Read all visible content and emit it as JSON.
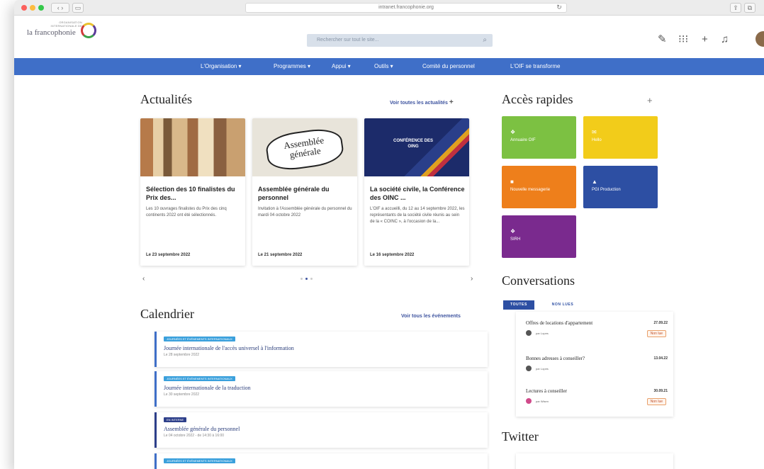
{
  "browser": {
    "url": "intranet.francophonie.org"
  },
  "header": {
    "logo_small": "ORGANISATION INTERNATIONALE DE",
    "logo_text": "la francophonie",
    "search_placeholder": "Rechercher sur tout le site..."
  },
  "nav": [
    "L'Organisation ▾",
    "Programmes ▾",
    "Appui ▾",
    "Outils ▾",
    "Comité du personnel",
    "L'OIF se transforme"
  ],
  "news": {
    "title": "Actualités",
    "see_all": "Voir toutes les actualités",
    "items": [
      {
        "title": "Sélection des 10 finalistes du Prix des...",
        "desc": "Les 10 ouvrages finalistes du Prix des cinq continents 2022 ont été sélectionnés.",
        "date": "Le 23 septembre 2022"
      },
      {
        "title": "Assemblée générale du personnel",
        "desc": "Invitation à l'Assemblée générale du personnel du mardi 04 octobre 2022",
        "date": "Le 21 septembre 2022"
      },
      {
        "title": "La société civile, la Conférence des OINC ...",
        "desc": "L'OIF a accueilli, du 12 au 14 septembre 2022, les représentants de la société civile réunis au sein de la « COINC », à l'occasion de la...",
        "date": "Le 16 septembre 2022"
      }
    ],
    "img2_text": "Assemblée générale",
    "img3_text": "CONFÉRENCE DES OING"
  },
  "calendar": {
    "title": "Calendrier",
    "see_all": "Voir tous les événements",
    "events": [
      {
        "tag": "JOURNÉES ET ÉVÉNEMENTS INTERNATIONAUX",
        "title": "Journée internationale de l'accès universel à l'information",
        "date": "Le 28 septembre 2022"
      },
      {
        "tag": "JOURNÉES ET ÉVÉNEMENTS INTERNATIONAUX",
        "title": "Journée internationale de la traduction",
        "date": "Le 30 septembre 2022"
      },
      {
        "tag": "EN INTERNE",
        "title": "Assemblée générale du personnel",
        "date": "Le 04 octobre 2022 - de 14:30 à 16:00"
      },
      {
        "tag": "JOURNÉES ET ÉVÉNEMENTS INTERNATIONAUX",
        "title": "",
        "date": ""
      }
    ]
  },
  "quick": {
    "title": "Accès rapides",
    "tiles": [
      {
        "label": "Annuaire OIF",
        "color": "#7cc142"
      },
      {
        "label": "Hello",
        "color": "#f2cc1a"
      },
      {
        "label": "Nouvelle messagerie",
        "color": "#ee7f1b"
      },
      {
        "label": "PGI Production",
        "color": "#2d4fa3"
      },
      {
        "label": "SIRH",
        "color": "#7a2a8e"
      }
    ]
  },
  "conversations": {
    "title": "Conversations",
    "tab_all": "TOUTES",
    "tab_unread": "NON LUES",
    "items": [
      {
        "title": "Offres de locations d'appartement",
        "date": "27.09.22",
        "author": "par Lopes",
        "badge": "Non lue"
      },
      {
        "title": "Bonnes adresses à conseiller?",
        "date": "13.04.22",
        "author": "par Lopes",
        "badge": ""
      },
      {
        "title": "Lectures à conseiller",
        "date": "30.09.21",
        "author": "par Wisen",
        "badge": "Non lue"
      }
    ]
  },
  "twitter": {
    "title": "Twitter"
  },
  "colors": {
    "nav": "#3f6fc8",
    "accent": "#3f55a0"
  }
}
